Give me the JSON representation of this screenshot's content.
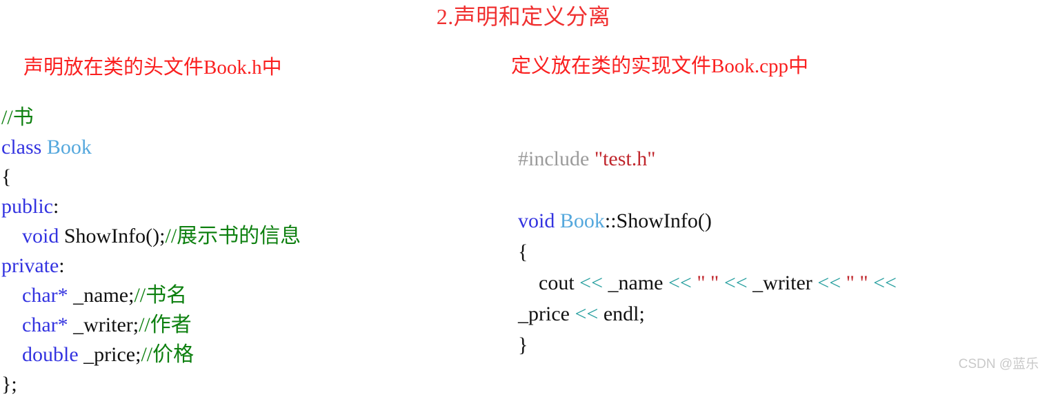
{
  "slide": {
    "title": "2.声明和定义分离",
    "title_color": "#f03030",
    "background": "#ffffff"
  },
  "left_column": {
    "header": "声明放在类的头文件Book.h中",
    "header_color": "#fa2020",
    "code_lines": [
      {
        "indent": "",
        "tokens": [
          {
            "text": "//书",
            "kind": "comment"
          }
        ]
      },
      {
        "indent": "",
        "tokens": [
          {
            "text": "class ",
            "kind": "keyword"
          },
          {
            "text": "Book",
            "kind": "type"
          }
        ]
      },
      {
        "indent": "",
        "tokens": [
          {
            "text": "{",
            "kind": "plain"
          }
        ]
      },
      {
        "indent": "",
        "tokens": [
          {
            "text": "public",
            "kind": "keyword"
          },
          {
            "text": ":",
            "kind": "plain"
          }
        ]
      },
      {
        "indent": "    ",
        "tokens": [
          {
            "text": "void ",
            "kind": "keyword"
          },
          {
            "text": "ShowInfo();",
            "kind": "plain"
          },
          {
            "text": "//展示书的信息",
            "kind": "comment"
          }
        ]
      },
      {
        "indent": "",
        "tokens": [
          {
            "text": "private",
            "kind": "keyword"
          },
          {
            "text": ":",
            "kind": "plain"
          }
        ]
      },
      {
        "indent": "    ",
        "tokens": [
          {
            "text": "char*",
            "kind": "keyword"
          },
          {
            "text": " _name;",
            "kind": "plain"
          },
          {
            "text": "//书名",
            "kind": "comment"
          }
        ]
      },
      {
        "indent": "    ",
        "tokens": [
          {
            "text": "char*",
            "kind": "keyword"
          },
          {
            "text": " _writer;",
            "kind": "plain"
          },
          {
            "text": "//作者",
            "kind": "comment"
          }
        ]
      },
      {
        "indent": "    ",
        "tokens": [
          {
            "text": "double",
            "kind": "keyword"
          },
          {
            "text": " _price;",
            "kind": "plain"
          },
          {
            "text": "//价格",
            "kind": "comment"
          }
        ]
      },
      {
        "indent": "",
        "tokens": [
          {
            "text": "};",
            "kind": "plain"
          }
        ]
      }
    ]
  },
  "right_column": {
    "header": "定义放在类的实现文件Book.cpp中",
    "header_color": "#fa2020",
    "code_lines": [
      {
        "indent": "",
        "tokens": [
          {
            "text": "#include ",
            "kind": "preproc"
          },
          {
            "text": "\"test.h\"",
            "kind": "string"
          }
        ]
      },
      {
        "indent": "",
        "tokens": [
          {
            "text": " ",
            "kind": "blank"
          }
        ]
      },
      {
        "indent": "",
        "tokens": [
          {
            "text": "void ",
            "kind": "keyword"
          },
          {
            "text": "Book",
            "kind": "type"
          },
          {
            "text": "::ShowInfo()",
            "kind": "plain"
          }
        ]
      },
      {
        "indent": "",
        "tokens": [
          {
            "text": "{",
            "kind": "plain"
          }
        ]
      },
      {
        "indent": "    ",
        "tokens": [
          {
            "text": "cout ",
            "kind": "plain"
          },
          {
            "text": "<<",
            "kind": "operator"
          },
          {
            "text": " _name ",
            "kind": "plain"
          },
          {
            "text": "<<",
            "kind": "operator"
          },
          {
            "text": " ",
            "kind": "plain"
          },
          {
            "text": "\" \"",
            "kind": "string"
          },
          {
            "text": " ",
            "kind": "plain"
          },
          {
            "text": "<<",
            "kind": "operator"
          },
          {
            "text": " _writer ",
            "kind": "plain"
          },
          {
            "text": "<<",
            "kind": "operator"
          },
          {
            "text": " ",
            "kind": "plain"
          },
          {
            "text": "\" \"",
            "kind": "string"
          },
          {
            "text": " ",
            "kind": "plain"
          },
          {
            "text": "<<",
            "kind": "operator"
          }
        ]
      },
      {
        "indent": "",
        "tokens": [
          {
            "text": "_price ",
            "kind": "plain"
          },
          {
            "text": "<<",
            "kind": "operator"
          },
          {
            "text": " endl;",
            "kind": "plain"
          }
        ]
      },
      {
        "indent": "",
        "tokens": [
          {
            "text": "}",
            "kind": "plain"
          }
        ]
      }
    ]
  },
  "watermark": {
    "text": "CSDN @蓝乐",
    "color": "#c9c9c9"
  },
  "token_colors": {
    "keyword": "#3333e0",
    "type": "#55a8dd",
    "plain": "#111111",
    "comment": "#0e8010",
    "preproc": "#9b9b9b",
    "string": "#c0272d",
    "operator": "#29a0a0"
  }
}
